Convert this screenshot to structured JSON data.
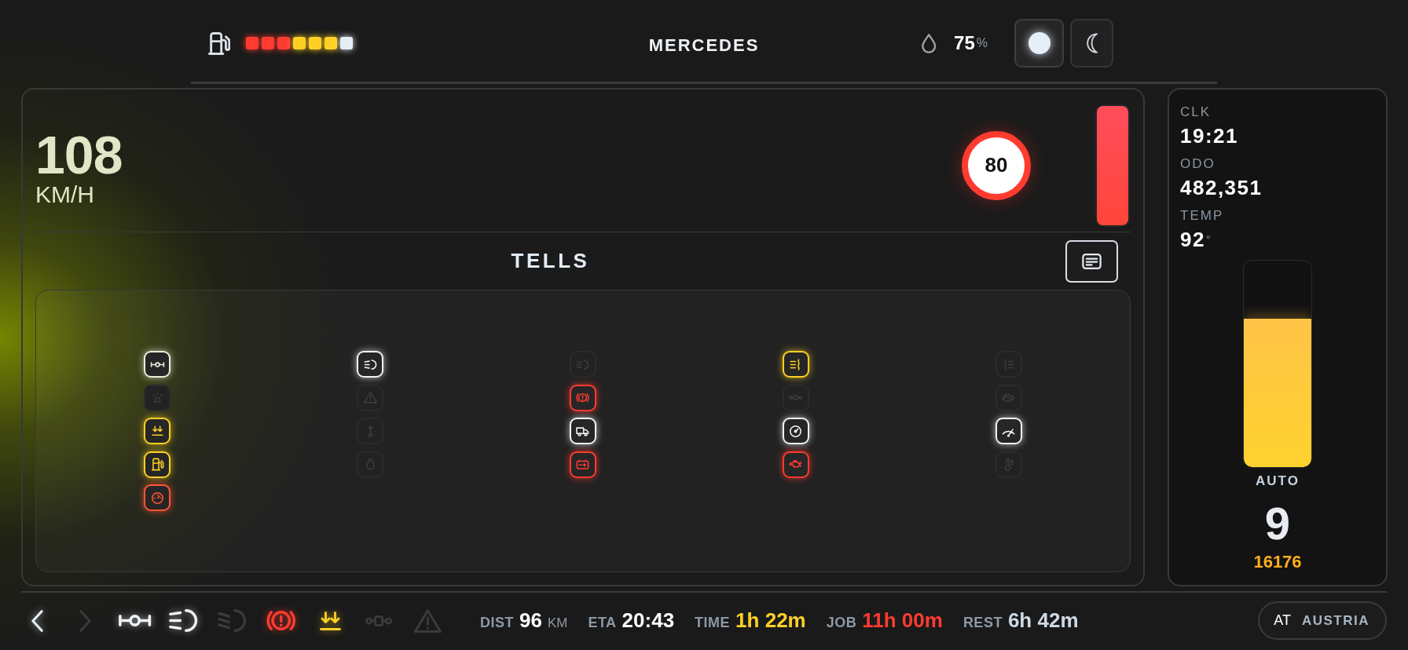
{
  "top_bar": {
    "fuel_gauge": {
      "segments": [
        {
          "color": "#ff3b30"
        },
        {
          "color": "#ff3b30"
        },
        {
          "color": "#ff3b30"
        },
        {
          "color": "#ffd024"
        },
        {
          "color": "#ffd024"
        },
        {
          "color": "#ffd024"
        },
        {
          "color": "#e6edf5"
        }
      ]
    },
    "title": "MERCEDES",
    "humidity": {
      "value": "75",
      "unit": "%"
    },
    "theme_buttons": [
      {
        "kind": "day",
        "selected": true
      },
      {
        "kind": "night",
        "selected": false
      }
    ]
  },
  "speed": {
    "value": "108",
    "unit": "KM/H",
    "limit": "80",
    "meter": {
      "level": 1
    }
  },
  "tells": {
    "title": "TELLS",
    "columns": [
      {
        "items": [
          {
            "kind": "axle",
            "lit": true,
            "color": "#e9eedb"
          },
          {
            "kind": "beacon",
            "lit": false
          },
          {
            "kind": "retarder",
            "lit": true,
            "color": "#ffd024"
          },
          {
            "kind": "fuel",
            "lit": true,
            "color": "#ffd024"
          },
          {
            "kind": "dial",
            "lit": true,
            "color": "#ff5533"
          }
        ]
      },
      {
        "items": [
          {
            "kind": "high_beam",
            "lit": true,
            "color": "#eef2f6"
          },
          {
            "kind": "warning",
            "lit": false
          },
          {
            "kind": "up_arrow",
            "lit": false
          },
          {
            "kind": "drop",
            "lit": false
          }
        ]
      },
      {
        "items": [
          {
            "kind": "low_beam",
            "lit": false
          },
          {
            "kind": "parking_brake",
            "lit": true,
            "color": "#ff3b30"
          },
          {
            "kind": "truck",
            "lit": true,
            "color": "#eef2f6"
          },
          {
            "kind": "battery",
            "lit": true,
            "color": "#ff3b30"
          }
        ]
      },
      {
        "items": [
          {
            "kind": "fog_front",
            "lit": true,
            "color": "#ffd024"
          },
          {
            "kind": "diff_lock",
            "lit": false
          },
          {
            "kind": "speedometer",
            "lit": true,
            "color": "#eef2f6"
          },
          {
            "kind": "oil_can",
            "lit": true,
            "color": "#ff3b30"
          }
        ]
      },
      {
        "items": [
          {
            "kind": "fog_rear",
            "lit": false
          },
          {
            "kind": "engine",
            "lit": false
          },
          {
            "kind": "wiper",
            "lit": true,
            "color": "#eef2f6"
          },
          {
            "kind": "thermometer",
            "lit": false
          }
        ]
      }
    ]
  },
  "info": [
    {
      "label": "CLK",
      "value": "19:21"
    },
    {
      "label": "ODO",
      "value": "482,351"
    },
    {
      "label": "TEMP",
      "value": "92",
      "unit": "°"
    }
  ],
  "gearbox": {
    "level": 0.72,
    "mode": "AUTO",
    "gear": "9",
    "reading": "16176"
  },
  "bottom_bar": {
    "nav": [
      {
        "kind": "back",
        "disabled": false
      },
      {
        "kind": "forward",
        "disabled": true
      }
    ],
    "indicators": [
      {
        "kind": "axle",
        "lit": true,
        "color": "#eef2f6"
      },
      {
        "kind": "high_beam",
        "lit": true,
        "color": "#eef2f6"
      },
      {
        "kind": "low_beam",
        "lit": false
      },
      {
        "kind": "parking_brake",
        "lit": true,
        "color": "#ff3b30"
      },
      {
        "kind": "retarder",
        "lit": true,
        "color": "#ffd024"
      },
      {
        "kind": "diff_lock",
        "lit": false
      },
      {
        "kind": "warning",
        "lit": false
      }
    ],
    "stats": [
      {
        "label": "DIST",
        "value": "96",
        "unit": "KM",
        "color": "#ffffff"
      },
      {
        "label": "ETA",
        "value": "20:43",
        "color": "#ffffff"
      },
      {
        "label": "TIME",
        "value": "1h 22m",
        "color": "#ffd024"
      },
      {
        "label": "JOB",
        "value": "11h 00m",
        "color": "#ff3b30"
      },
      {
        "label": "REST",
        "value": "6h 42m",
        "color": "#cfd9e4"
      }
    ],
    "country": {
      "code": "AT",
      "name": "AUSTRIA"
    }
  }
}
